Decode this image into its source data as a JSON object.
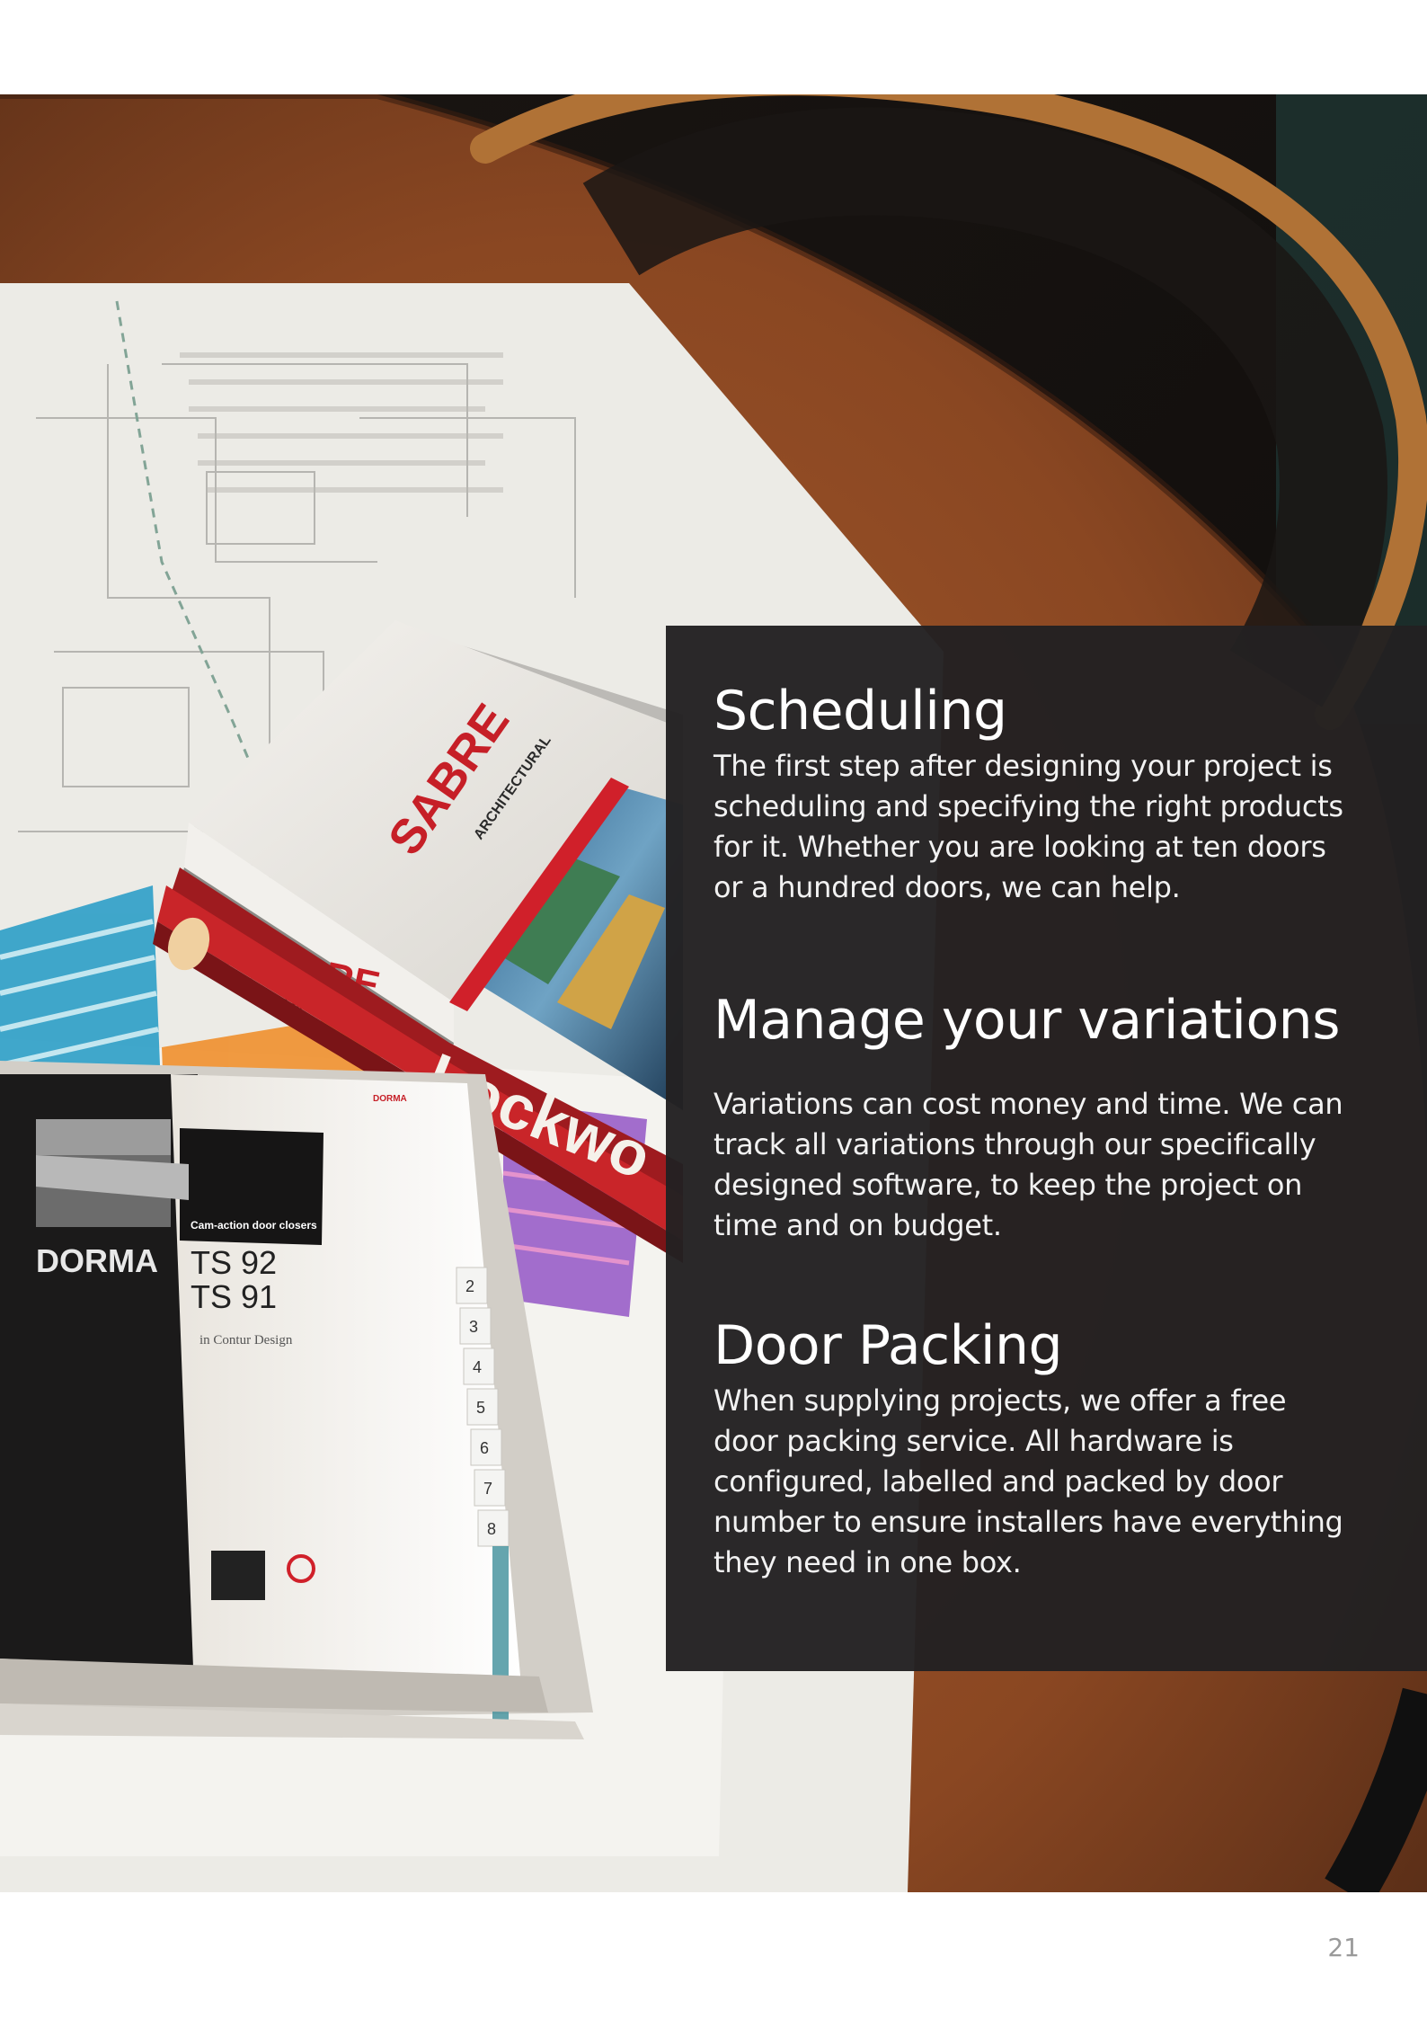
{
  "photo": {
    "alt": "",
    "binders": {
      "sabre_brand": "SABRE",
      "sabre_sub": "ARCHITECTURAL",
      "lockwood_brand": "Lockwo",
      "dorma_brand": "DORMA",
      "dorma_badge": "DORMA",
      "dorma_caption": "Cam-action door closers",
      "dorma_model_1": "TS 92",
      "dorma_model_2": "TS 91",
      "dorma_design": "in Contur Design",
      "tabs": [
        "2",
        "3",
        "4",
        "5",
        "6",
        "7",
        "8"
      ]
    }
  },
  "sections": [
    {
      "title": "Scheduling",
      "body": "The first step after designing your project is scheduling and specifying the right products for it. Whether you are looking at ten doors or a hundred doors, we can help."
    },
    {
      "title": "Manage your variations",
      "body": "Variations can cost money and time. We can track all variations through our specifically designed software, to keep the project on time and on budget."
    },
    {
      "title": "Door Packing",
      "body": "When supplying projects, we offer a free door packing service. All hardware is configured, labelled and packed by door number to ensure installers have everything they need in one box."
    }
  ],
  "page_number": "21",
  "colors": {
    "panel": "#232122",
    "table_wood": "#8a4a25",
    "sabre_red": "#d0202a",
    "lockwood_red": "#c4242a",
    "dorma_black": "#1b1a1a"
  }
}
